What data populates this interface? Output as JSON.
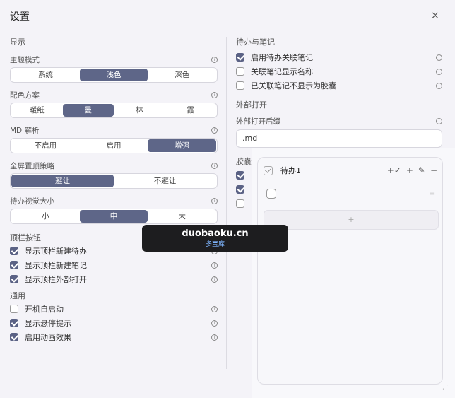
{
  "dialog": {
    "title": "设置",
    "close": "×"
  },
  "display": {
    "section": "显示",
    "theme": {
      "label": "主题模式",
      "options": [
        "系统",
        "浅色",
        "深色"
      ],
      "selected": "浅色"
    },
    "palette": {
      "label": "配色方案",
      "options": [
        "暖纸",
        "曼",
        "林",
        "霞"
      ],
      "selected": "曼"
    },
    "md": {
      "label": "MD 解析",
      "options": [
        "不启用",
        "启用",
        "增强"
      ],
      "selected": "增强"
    },
    "fullscreen": {
      "label": "全屏置顶策略",
      "options": [
        "避让",
        "不避让"
      ],
      "selected": "避让"
    },
    "todo_size": {
      "label": "待办视觉大小",
      "options": [
        "小",
        "中",
        "大"
      ],
      "selected": "中"
    }
  },
  "topbar": {
    "section": "顶栏按钮",
    "items": [
      {
        "label": "显示顶栏新建待办",
        "checked": true
      },
      {
        "label": "显示顶栏新建笔记",
        "checked": true
      },
      {
        "label": "显示顶栏外部打开",
        "checked": true
      }
    ]
  },
  "general": {
    "section": "通用",
    "items": [
      {
        "label": "开机自启动",
        "checked": false
      },
      {
        "label": "显示悬停提示",
        "checked": true
      },
      {
        "label": "启用动画效果",
        "checked": true
      }
    ]
  },
  "todo_notes": {
    "section": "待办与笔记",
    "items": [
      {
        "label": "启用待办关联笔记",
        "checked": true
      },
      {
        "label": "关联笔记显示名称",
        "checked": false
      },
      {
        "label": "已关联笔记不显示为胶囊",
        "checked": false
      }
    ]
  },
  "external": {
    "section": "外部打开",
    "suffix_label": "外部打开后缀",
    "suffix_value": ".md"
  },
  "capsule": {
    "section_partial": "胶囊"
  },
  "todo_card": {
    "title": "待办1",
    "tools": [
      "+✓",
      "+",
      "✎",
      "−"
    ],
    "add_symbol": "+"
  },
  "watermark": {
    "line1": "duobaoku.cn",
    "line2": "多宝库"
  },
  "colors": {
    "accent": "#5e6688",
    "background": "#f4f3f8"
  },
  "icons": [
    "info-icon",
    "close-icon",
    "checkbox-icon",
    "pencil-icon",
    "grip-icon",
    "resize-grip-icon"
  ]
}
